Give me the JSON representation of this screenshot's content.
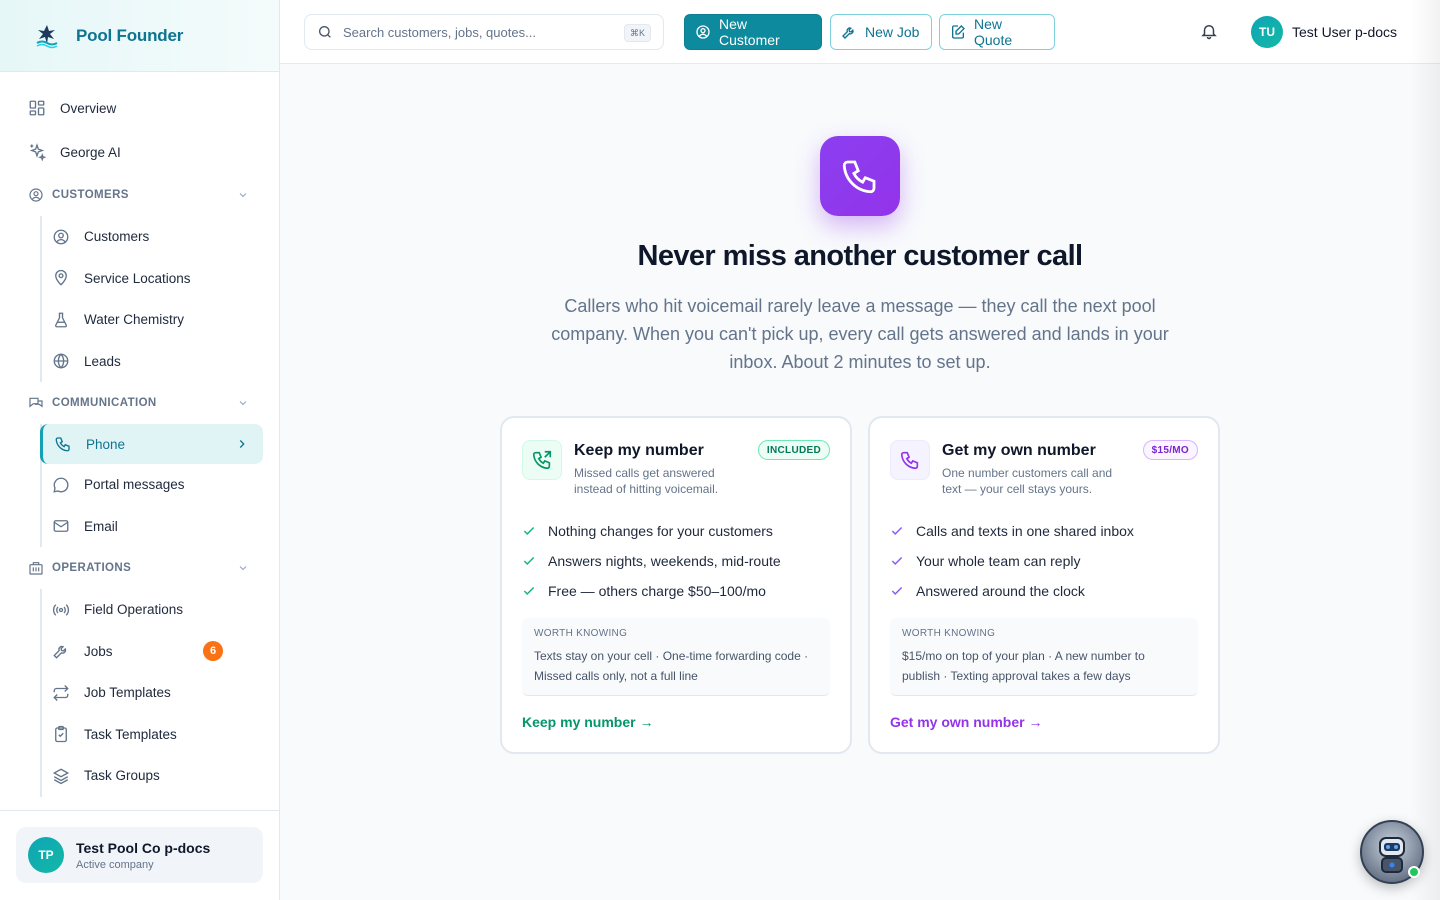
{
  "brand": {
    "name": "Pool Founder"
  },
  "sidebar": {
    "top_items": [
      {
        "label": "Overview",
        "icon": "grid-icon"
      },
      {
        "label": "George AI",
        "icon": "sparkles-icon"
      }
    ],
    "sections": [
      {
        "title": "CUSTOMERS",
        "items": [
          {
            "label": "Customers",
            "icon": "user-circle-icon"
          },
          {
            "label": "Service Locations",
            "icon": "map-pin-icon"
          },
          {
            "label": "Water Chemistry",
            "icon": "flask-icon"
          },
          {
            "label": "Leads",
            "icon": "globe-icon"
          }
        ]
      },
      {
        "title": "COMMUNICATION",
        "items": [
          {
            "label": "Phone",
            "icon": "phone-icon",
            "active": true
          },
          {
            "label": "Portal messages",
            "icon": "chat-bubble-icon"
          },
          {
            "label": "Email",
            "icon": "mail-icon"
          }
        ]
      },
      {
        "title": "OPERATIONS",
        "items": [
          {
            "label": "Field Operations",
            "icon": "radio-icon"
          },
          {
            "label": "Jobs",
            "icon": "wrench-icon",
            "badge": "6"
          },
          {
            "label": "Job Templates",
            "icon": "repeat-icon"
          },
          {
            "label": "Task Templates",
            "icon": "clipboard-icon"
          },
          {
            "label": "Task Groups",
            "icon": "layers-icon"
          }
        ]
      }
    ],
    "company": {
      "initials": "TP",
      "name": "Test Pool Co p-docs",
      "subtitle": "Active company"
    }
  },
  "topbar": {
    "search_placeholder": "Search customers, jobs, quotes...",
    "search_shortcut": "⌘K",
    "new_customer": "New Customer",
    "new_job": "New Job",
    "new_quote": "New Quote",
    "user_initials": "TU",
    "user_name": "Test User p-docs"
  },
  "hero": {
    "title": "Never miss another customer call",
    "subtitle": "Callers who hit voicemail rarely leave a message — they call the next pool company. When you can't pick up, every call gets answered and lands in your inbox. About 2 minutes to set up."
  },
  "cards": {
    "keep": {
      "title": "Keep my number",
      "badge": "INCLUDED",
      "description": "Missed calls get answered instead of hitting voicemail.",
      "features": [
        "Nothing changes for your customers",
        "Answers nights, weekends, mid-route",
        "Free — others charge $50–100/mo"
      ],
      "note_label": "WORTH KNOWING",
      "note_text": "Texts stay on your cell · One-time forwarding code · Missed calls only, not a full line",
      "cta": "Keep my number →"
    },
    "own": {
      "title": "Get my own number",
      "badge": "$15/MO",
      "description": "One number customers call and text — your cell stays yours.",
      "features": [
        "Calls and texts in one shared inbox",
        "Your whole team can reply",
        "Answered around the clock"
      ],
      "note_label": "WORTH KNOWING",
      "note_text": "$15/mo on top of your plan · A new number to publish · Texting approval takes a few days",
      "cta": "Get my own number →"
    }
  },
  "colors": {
    "brand_teal": "#0e8a9e",
    "accent_purple": "#9333ea",
    "accent_green": "#059669",
    "badge_orange": "#f97316"
  }
}
